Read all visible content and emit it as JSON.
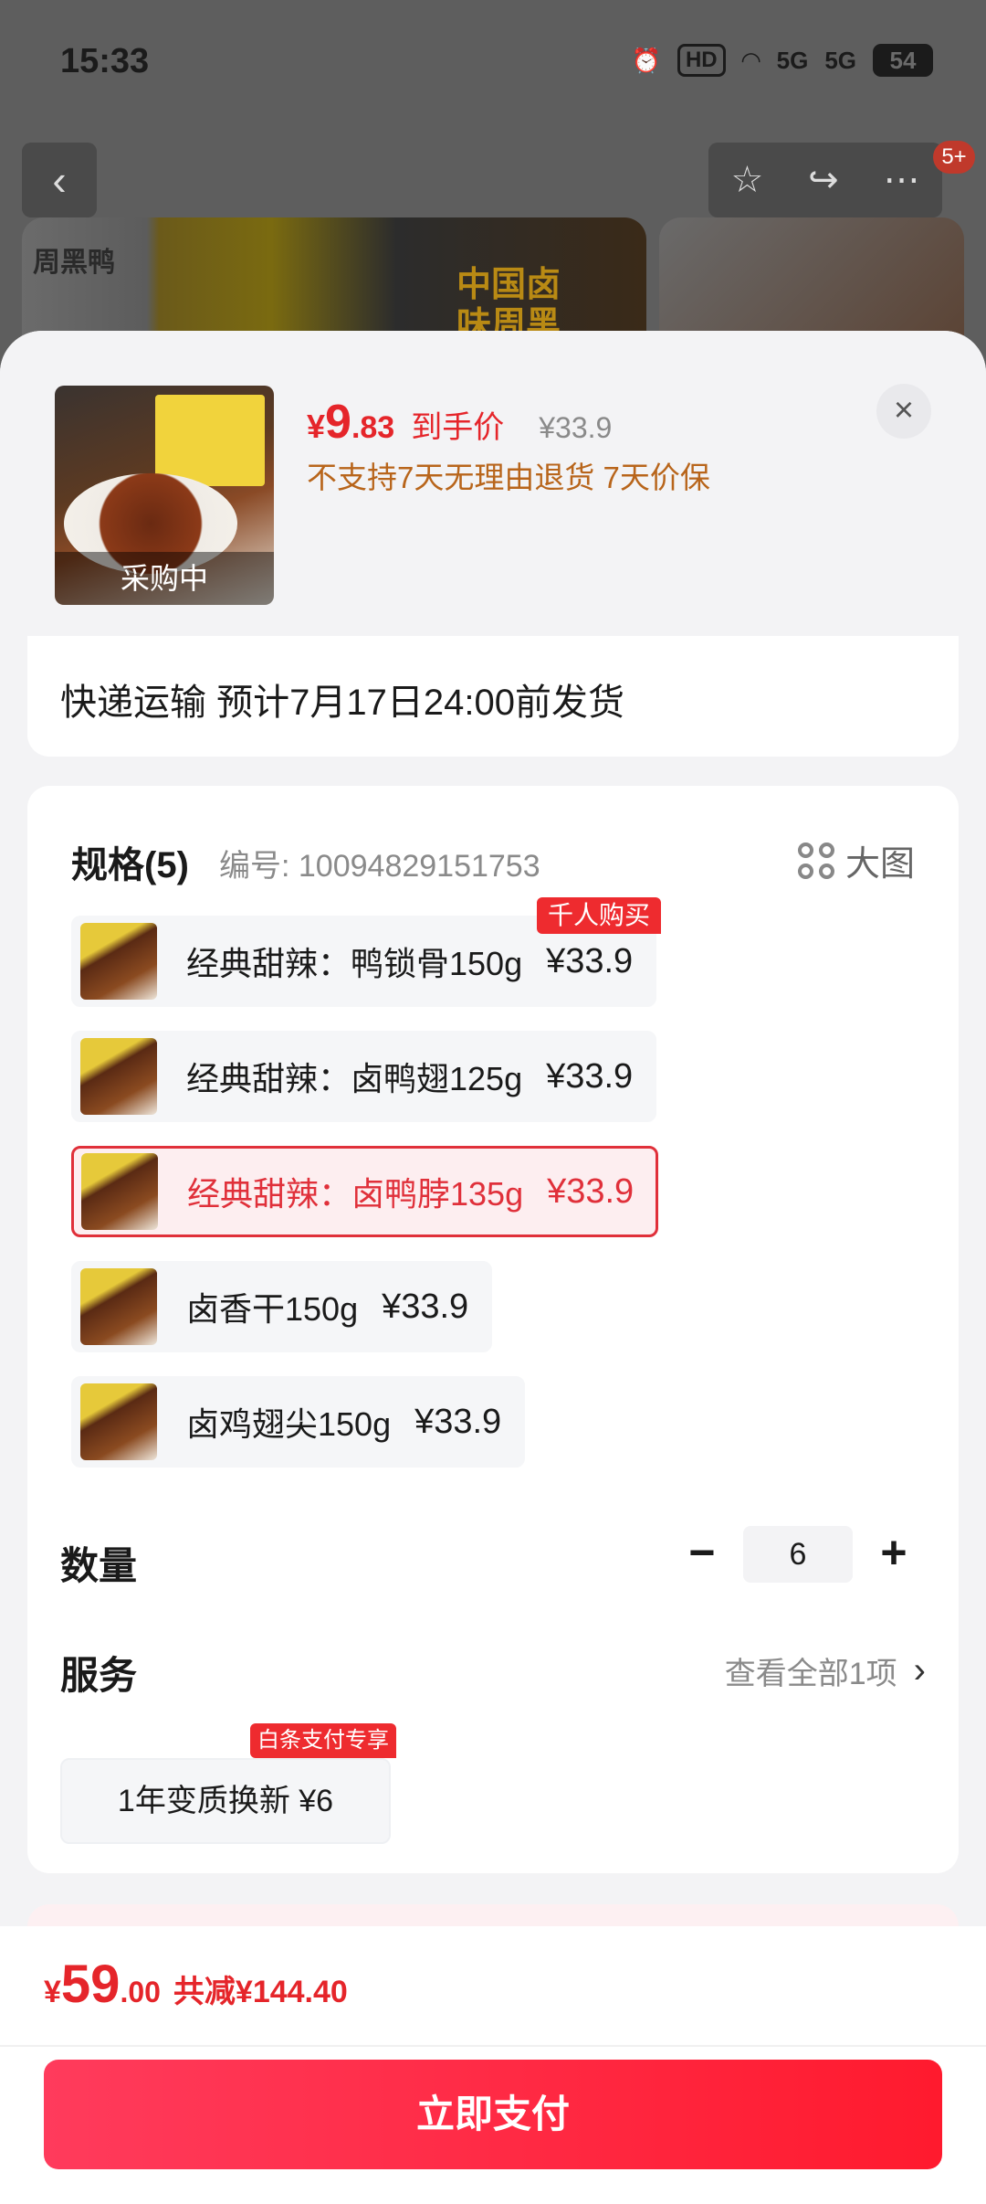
{
  "status_bar": {
    "time": "15:33",
    "hd_label": "HD",
    "net1": "5G",
    "net2": "5G",
    "battery": "54"
  },
  "top_bar": {
    "back_icon": "back-icon",
    "favorite_icon": "star-icon",
    "share_icon": "share-icon",
    "more_icon": "more-icon",
    "message_badge": "5+"
  },
  "background_banner": {
    "brand_logo_text": "周黑鸭",
    "title": "中国卤味周黑鸭"
  },
  "product": {
    "image_label": "采购中",
    "currency": "¥",
    "price_integer": "9",
    "price_decimal": ".83",
    "price_tag": "到手价",
    "original_price": "¥33.9",
    "notice": "不支持7天无理由退货  7天价保",
    "close_icon": "close-icon"
  },
  "shipping": {
    "text": "快递运输 预计7月17日24:00前发货"
  },
  "spec": {
    "title": "规格(5)",
    "code": "编号: 10094829151753",
    "big_image_label": "大图",
    "hot_badge": "千人购买",
    "options": [
      {
        "name": "经典甜辣：鸭锁骨150g",
        "price": "¥33.9",
        "selected": false
      },
      {
        "name": "经典甜辣：卤鸭翅125g",
        "price": "¥33.9",
        "selected": false
      },
      {
        "name": "经典甜辣：卤鸭脖135g",
        "price": "¥33.9",
        "selected": true
      },
      {
        "name": "卤香干150g",
        "price": "¥33.9",
        "selected": false
      },
      {
        "name": "卤鸡翅尖150g",
        "price": "¥33.9",
        "selected": false
      }
    ]
  },
  "quantity": {
    "label": "数量",
    "minus": "−",
    "value": "6",
    "plus": "+"
  },
  "service": {
    "label": "服务",
    "view_all": "查看全部1项",
    "chevron": "›",
    "badge": "白条支付专享",
    "option": "1年变质换新 ¥6"
  },
  "footer": {
    "currency": "¥",
    "total_integer": "59",
    "total_decimal": ".00",
    "savings": "共减¥144.40",
    "pay_button": "立即支付"
  },
  "colors": {
    "accent_red": "#e5252a",
    "notice_orange": "#b8651b",
    "pay_gradient_start": "#ff3b5c",
    "pay_gradient_end": "#ff1a2e"
  }
}
